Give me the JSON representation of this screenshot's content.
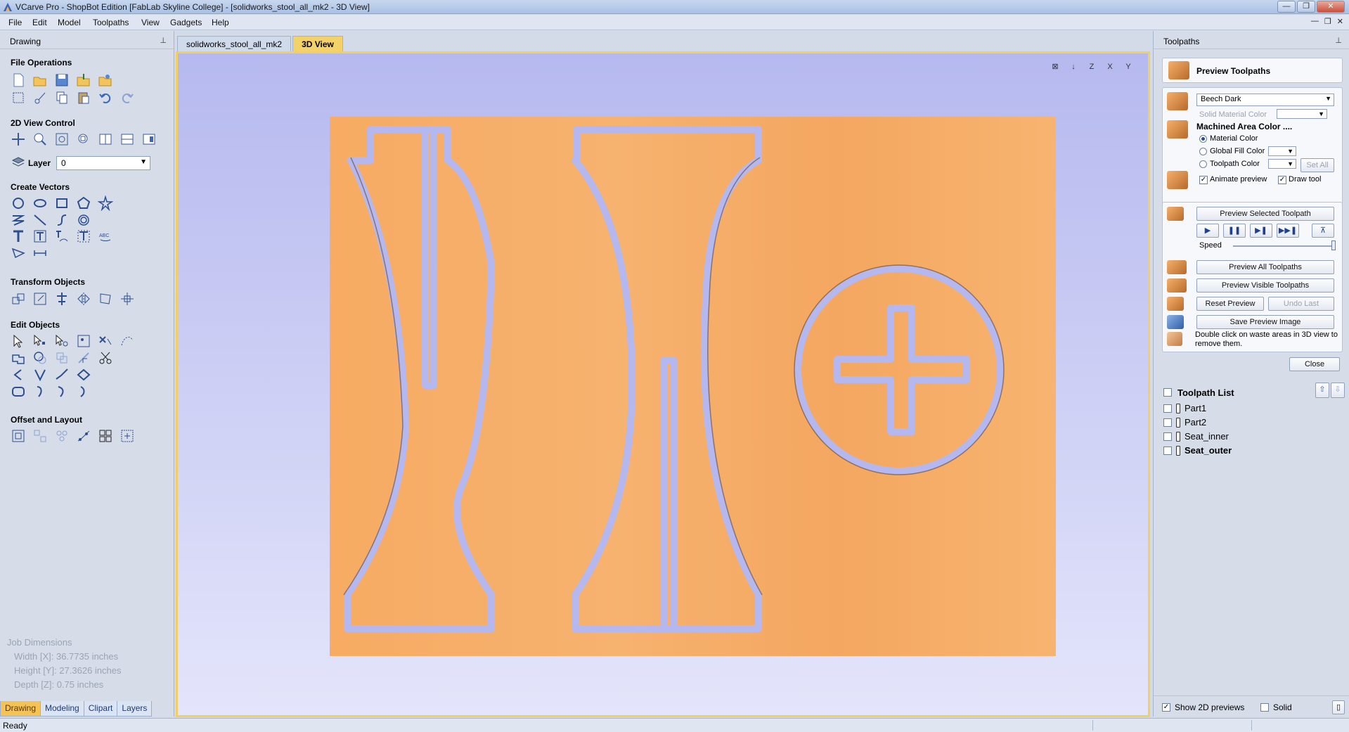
{
  "window": {
    "title": "VCarve Pro - ShopBot Edition [FabLab Skyline College] - [solidworks_stool_all_mk2 - 3D View]",
    "controls": [
      "—",
      "❐",
      "✕"
    ]
  },
  "menu": [
    "File",
    "Edit",
    "Model",
    "Toolpaths",
    "View",
    "Gadgets",
    "Help"
  ],
  "mdi_controls": [
    "—",
    "❐",
    "✕"
  ],
  "left_panel": {
    "title": "Drawing",
    "pin": "⊥",
    "sections": {
      "file_operations": "File Operations",
      "view_control": "2D View Control",
      "create_vectors": "Create Vectors",
      "transform_objects": "Transform Objects",
      "edit_objects": "Edit Objects",
      "offset_layout": "Offset and Layout"
    },
    "layer": {
      "label": "Layer",
      "value": "0"
    },
    "job_dimensions": {
      "title": "Job Dimensions",
      "width": "Width  [X]: 36.7735 inches",
      "height": "Height [Y]: 27.3626 inches",
      "depth": "Depth  [Z]: 0.75 inches"
    },
    "tabs": [
      "Drawing",
      "Modeling",
      "Clipart",
      "Layers"
    ]
  },
  "document_tabs": [
    "solidworks_stool_all_mk2",
    "3D View"
  ],
  "view_controls": [
    "⊠",
    "↓",
    "Z",
    "X",
    "Y"
  ],
  "right_panel": {
    "title": "Toolpaths",
    "pin": "⊥",
    "preview_title": "Preview Toolpaths",
    "material_dropdown": "Beech Dark",
    "solid_material_color": "Solid Material Color",
    "machined_area_color": "Machined Area Color ....",
    "radio_material_color": "Material Color",
    "radio_global_fill": "Global Fill Color",
    "radio_toolpath_color": "Toolpath Color",
    "set_all": "Set All",
    "animate_preview": "Animate preview",
    "draw_tool": "Draw tool",
    "preview_selected": "Preview Selected Toolpath",
    "playback": [
      "▶",
      "❚❚",
      "▶❚",
      "▶▶❚",
      "⊼"
    ],
    "speed_label": "Speed",
    "speed_value": 1.0,
    "preview_all": "Preview All Toolpaths",
    "preview_visible": "Preview Visible Toolpaths",
    "reset_preview": "Reset Preview",
    "undo_last": "Undo Last",
    "save_preview": "Save Preview Image",
    "hint": "Double click on waste areas in 3D view to remove them.",
    "close": "Close",
    "toolpath_list_title": "Toolpath List",
    "toolpaths": [
      "Part1",
      "Part2",
      "Seat_inner",
      "Seat_outer"
    ],
    "show_2d_previews": "Show 2D previews",
    "solid": "Solid"
  },
  "status": {
    "text": "Ready"
  },
  "colors": {
    "material": "#f6ad66",
    "cut": "#b5b8ee",
    "active_tab": "#f4c255"
  }
}
